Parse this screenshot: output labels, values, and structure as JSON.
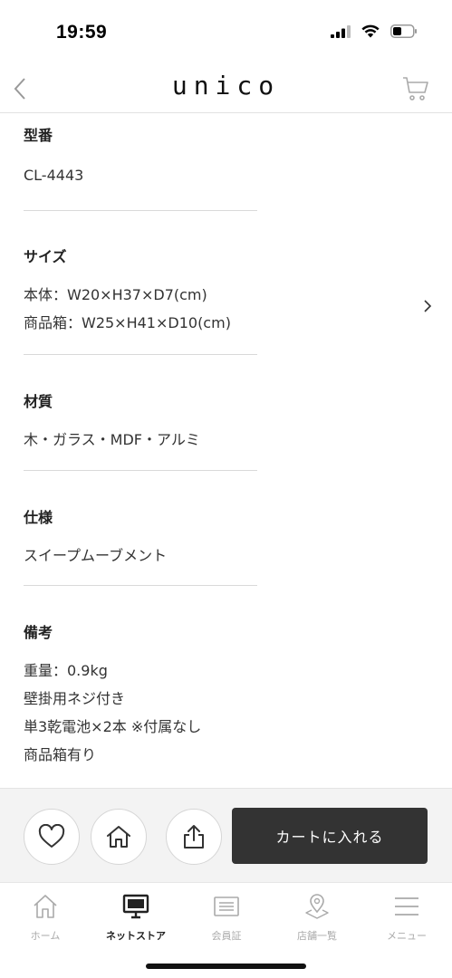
{
  "status_bar": {
    "time": "19:59"
  },
  "header": {
    "logo": "unico"
  },
  "specs": {
    "model": {
      "label": "型番",
      "value": "CL-4443"
    },
    "size": {
      "label": "サイズ",
      "lines": [
        "本体：W20×H37×D7(cm)",
        "商品箱：W25×H41×D10(cm)"
      ]
    },
    "material": {
      "label": "材質",
      "value": "木・ガラス・MDF・アルミ"
    },
    "spec": {
      "label": "仕様",
      "value": "スイープムーブメント"
    },
    "notes": {
      "label": "備考",
      "lines": [
        "重量：0.9kg",
        "壁掛用ネジ付き",
        "単3乾電池×2本 ※付属なし",
        "商品箱有り"
      ]
    }
  },
  "actions": {
    "add_to_cart_label": "カートに入れる"
  },
  "tab_bar": {
    "items": [
      {
        "label": "ホーム",
        "icon": "home-icon",
        "active": false
      },
      {
        "label": "ネットストア",
        "icon": "monitor-icon",
        "active": true
      },
      {
        "label": "会員証",
        "icon": "member-card-icon",
        "active": false
      },
      {
        "label": "店舗一覧",
        "icon": "map-pin-icon",
        "active": false
      },
      {
        "label": "メニュー",
        "icon": "menu-icon",
        "active": false
      }
    ]
  },
  "colors": {
    "primary_button": "#333333",
    "active_tab": "#222222",
    "inactive_tab": "#aaaaaa",
    "action_bar_bg": "#f3f3f3"
  }
}
